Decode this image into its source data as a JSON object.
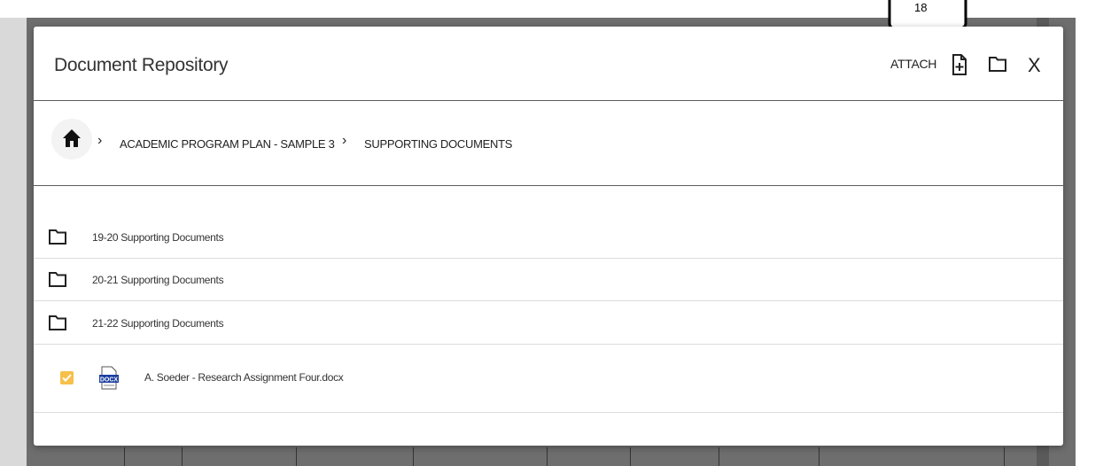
{
  "callout": {
    "number": "18"
  },
  "modal": {
    "title": "Document Repository",
    "attach_label": "ATTACH",
    "close_label": "X"
  },
  "breadcrumb": {
    "items": [
      "ACADEMIC PROGRAM PLAN - SAMPLE 3",
      "SUPPORTING DOCUMENTS"
    ]
  },
  "folders": [
    {
      "label": "19-20 Supporting Documents"
    },
    {
      "label": "20-21 Supporting Documents"
    },
    {
      "label": "21-22 Supporting Documents"
    }
  ],
  "files": [
    {
      "label": "A. Soeder - Research Assignment Four.docx",
      "checked": true,
      "file_type": "DOCX"
    }
  ],
  "colors": {
    "checkbox": "#f6c04a",
    "docx_icon": "#1b3fa0"
  }
}
